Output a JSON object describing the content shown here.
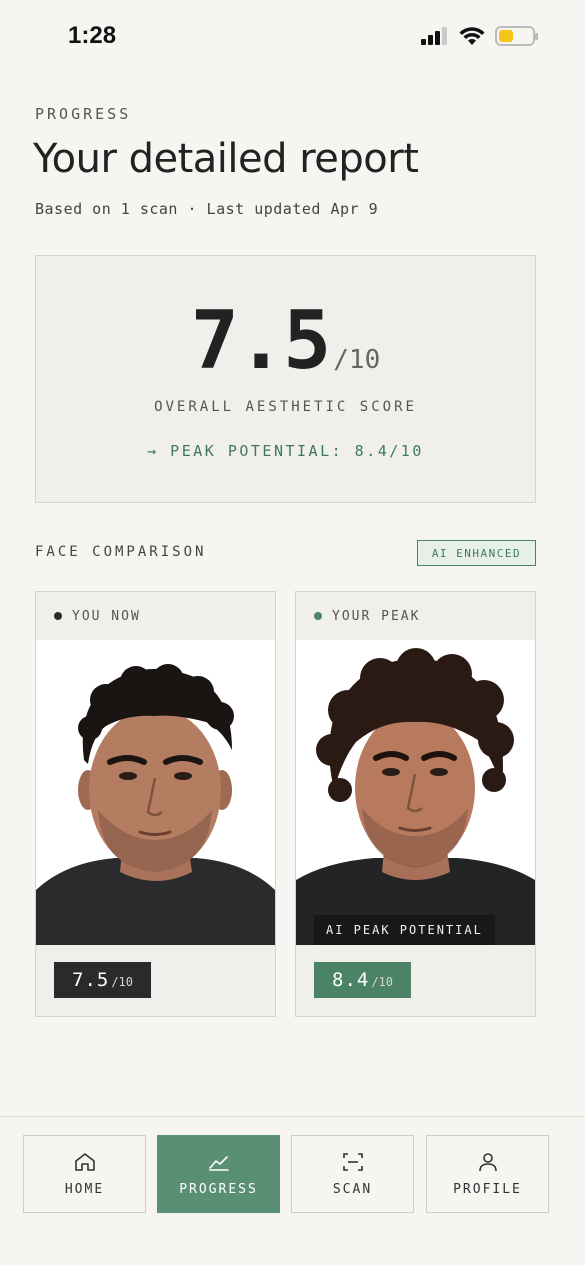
{
  "status_bar": {
    "time": "1:28",
    "battery_level": 0.45,
    "battery_color": "#f3c41a",
    "icons": [
      "cellular-signal-icon",
      "wifi-icon",
      "battery-icon"
    ]
  },
  "header": {
    "eyebrow": "PROGRESS",
    "title": "Your detailed report",
    "subtitle": "Based on 1 scan · Last updated Apr 9"
  },
  "score_card": {
    "score": "7.5",
    "denominator": "/10",
    "label": "OVERALL AESTHETIC SCORE",
    "peak_text": "→ PEAK POTENTIAL: 8.4/10"
  },
  "comparison": {
    "title": "FACE COMPARISON",
    "badge": "AI ENHANCED",
    "now": {
      "label": "YOU NOW",
      "score": "7.5",
      "denominator": "/10"
    },
    "peak": {
      "label": "YOUR PEAK",
      "caption": "AI PEAK POTENTIAL",
      "score": "8.4",
      "denominator": "/10"
    }
  },
  "nav": {
    "items": [
      {
        "label": "HOME",
        "icon": "home-icon"
      },
      {
        "label": "PROGRESS",
        "icon": "chart-icon",
        "active": true
      },
      {
        "label": "SCAN",
        "icon": "scan-icon"
      },
      {
        "label": "PROFILE",
        "icon": "profile-icon"
      }
    ]
  },
  "colors": {
    "accent": "#4b8367",
    "background": "#f6f5f2",
    "card": "#f0efeb",
    "dark_badge": "#2a2a2a"
  }
}
